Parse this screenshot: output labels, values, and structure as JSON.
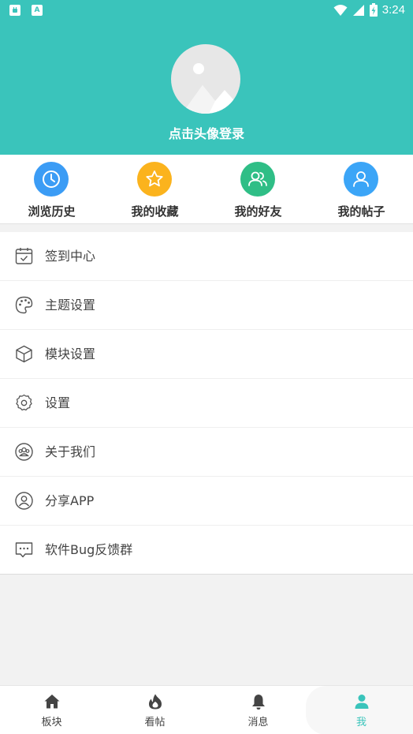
{
  "status_bar": {
    "time": "3:24",
    "notification_icons": [
      "android-icon",
      "a-icon"
    ],
    "indicator_icons": [
      "wifi-icon",
      "signal-icon",
      "battery-icon"
    ],
    "a_glyph": "A"
  },
  "colors": {
    "primary": "#3ac4bb",
    "history": "#3b9cf5",
    "favorites": "#fbb31d",
    "friends": "#2fbe86",
    "posts": "#3ba5f7"
  },
  "profile": {
    "login_prompt": "点击头像登录",
    "avatar_icon": "image-placeholder-icon"
  },
  "shortcuts": [
    {
      "label": "浏览历史",
      "icon": "clock-icon"
    },
    {
      "label": "我的收藏",
      "icon": "star-icon"
    },
    {
      "label": "我的好友",
      "icon": "friends-icon"
    },
    {
      "label": "我的帖子",
      "icon": "user-icon"
    }
  ],
  "menu": [
    {
      "label": "签到中心",
      "icon": "calendar-check-icon"
    },
    {
      "label": "主题设置",
      "icon": "palette-icon"
    },
    {
      "label": "模块设置",
      "icon": "cube-icon"
    },
    {
      "label": "设置",
      "icon": "gear-icon"
    },
    {
      "label": "关于我们",
      "icon": "group-icon"
    },
    {
      "label": "分享APP",
      "icon": "user-circle-icon"
    },
    {
      "label": "软件Bug反馈群",
      "icon": "chat-icon"
    }
  ],
  "bottom_nav": {
    "active": "我",
    "items": [
      {
        "label": "板块",
        "icon": "home-icon"
      },
      {
        "label": "看帖",
        "icon": "flame-icon"
      },
      {
        "label": "消息",
        "icon": "bell-icon"
      },
      {
        "label": "我",
        "icon": "person-icon"
      }
    ]
  }
}
